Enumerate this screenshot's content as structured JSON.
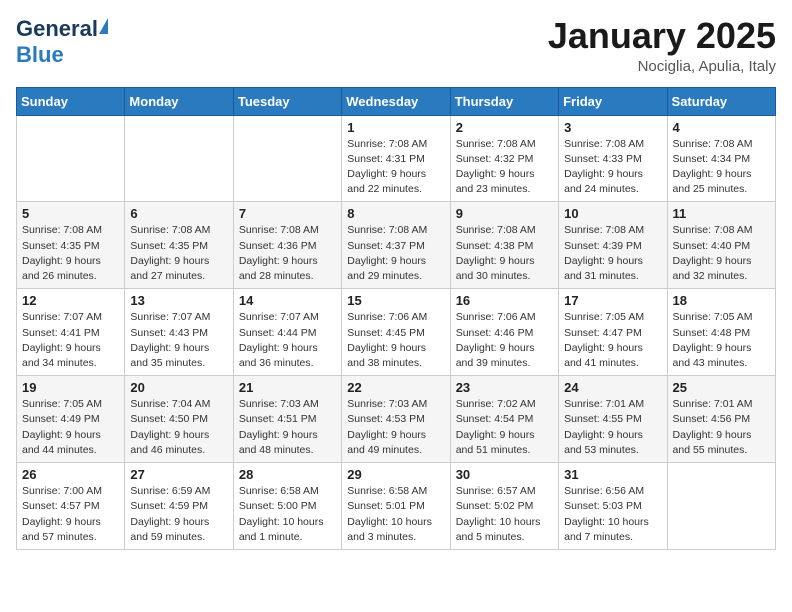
{
  "header": {
    "logo": {
      "general": "General",
      "blue": "Blue"
    },
    "title": "January 2025",
    "location": "Nociglia, Apulia, Italy"
  },
  "calendar": {
    "days_of_week": [
      "Sunday",
      "Monday",
      "Tuesday",
      "Wednesday",
      "Thursday",
      "Friday",
      "Saturday"
    ],
    "weeks": [
      [
        {
          "day": "",
          "info": ""
        },
        {
          "day": "",
          "info": ""
        },
        {
          "day": "",
          "info": ""
        },
        {
          "day": "1",
          "info": "Sunrise: 7:08 AM\nSunset: 4:31 PM\nDaylight: 9 hours\nand 22 minutes."
        },
        {
          "day": "2",
          "info": "Sunrise: 7:08 AM\nSunset: 4:32 PM\nDaylight: 9 hours\nand 23 minutes."
        },
        {
          "day": "3",
          "info": "Sunrise: 7:08 AM\nSunset: 4:33 PM\nDaylight: 9 hours\nand 24 minutes."
        },
        {
          "day": "4",
          "info": "Sunrise: 7:08 AM\nSunset: 4:34 PM\nDaylight: 9 hours\nand 25 minutes."
        }
      ],
      [
        {
          "day": "5",
          "info": "Sunrise: 7:08 AM\nSunset: 4:35 PM\nDaylight: 9 hours\nand 26 minutes."
        },
        {
          "day": "6",
          "info": "Sunrise: 7:08 AM\nSunset: 4:35 PM\nDaylight: 9 hours\nand 27 minutes."
        },
        {
          "day": "7",
          "info": "Sunrise: 7:08 AM\nSunset: 4:36 PM\nDaylight: 9 hours\nand 28 minutes."
        },
        {
          "day": "8",
          "info": "Sunrise: 7:08 AM\nSunset: 4:37 PM\nDaylight: 9 hours\nand 29 minutes."
        },
        {
          "day": "9",
          "info": "Sunrise: 7:08 AM\nSunset: 4:38 PM\nDaylight: 9 hours\nand 30 minutes."
        },
        {
          "day": "10",
          "info": "Sunrise: 7:08 AM\nSunset: 4:39 PM\nDaylight: 9 hours\nand 31 minutes."
        },
        {
          "day": "11",
          "info": "Sunrise: 7:08 AM\nSunset: 4:40 PM\nDaylight: 9 hours\nand 32 minutes."
        }
      ],
      [
        {
          "day": "12",
          "info": "Sunrise: 7:07 AM\nSunset: 4:41 PM\nDaylight: 9 hours\nand 34 minutes."
        },
        {
          "day": "13",
          "info": "Sunrise: 7:07 AM\nSunset: 4:43 PM\nDaylight: 9 hours\nand 35 minutes."
        },
        {
          "day": "14",
          "info": "Sunrise: 7:07 AM\nSunset: 4:44 PM\nDaylight: 9 hours\nand 36 minutes."
        },
        {
          "day": "15",
          "info": "Sunrise: 7:06 AM\nSunset: 4:45 PM\nDaylight: 9 hours\nand 38 minutes."
        },
        {
          "day": "16",
          "info": "Sunrise: 7:06 AM\nSunset: 4:46 PM\nDaylight: 9 hours\nand 39 minutes."
        },
        {
          "day": "17",
          "info": "Sunrise: 7:05 AM\nSunset: 4:47 PM\nDaylight: 9 hours\nand 41 minutes."
        },
        {
          "day": "18",
          "info": "Sunrise: 7:05 AM\nSunset: 4:48 PM\nDaylight: 9 hours\nand 43 minutes."
        }
      ],
      [
        {
          "day": "19",
          "info": "Sunrise: 7:05 AM\nSunset: 4:49 PM\nDaylight: 9 hours\nand 44 minutes."
        },
        {
          "day": "20",
          "info": "Sunrise: 7:04 AM\nSunset: 4:50 PM\nDaylight: 9 hours\nand 46 minutes."
        },
        {
          "day": "21",
          "info": "Sunrise: 7:03 AM\nSunset: 4:51 PM\nDaylight: 9 hours\nand 48 minutes."
        },
        {
          "day": "22",
          "info": "Sunrise: 7:03 AM\nSunset: 4:53 PM\nDaylight: 9 hours\nand 49 minutes."
        },
        {
          "day": "23",
          "info": "Sunrise: 7:02 AM\nSunset: 4:54 PM\nDaylight: 9 hours\nand 51 minutes."
        },
        {
          "day": "24",
          "info": "Sunrise: 7:01 AM\nSunset: 4:55 PM\nDaylight: 9 hours\nand 53 minutes."
        },
        {
          "day": "25",
          "info": "Sunrise: 7:01 AM\nSunset: 4:56 PM\nDaylight: 9 hours\nand 55 minutes."
        }
      ],
      [
        {
          "day": "26",
          "info": "Sunrise: 7:00 AM\nSunset: 4:57 PM\nDaylight: 9 hours\nand 57 minutes."
        },
        {
          "day": "27",
          "info": "Sunrise: 6:59 AM\nSunset: 4:59 PM\nDaylight: 9 hours\nand 59 minutes."
        },
        {
          "day": "28",
          "info": "Sunrise: 6:58 AM\nSunset: 5:00 PM\nDaylight: 10 hours\nand 1 minute."
        },
        {
          "day": "29",
          "info": "Sunrise: 6:58 AM\nSunset: 5:01 PM\nDaylight: 10 hours\nand 3 minutes."
        },
        {
          "day": "30",
          "info": "Sunrise: 6:57 AM\nSunset: 5:02 PM\nDaylight: 10 hours\nand 5 minutes."
        },
        {
          "day": "31",
          "info": "Sunrise: 6:56 AM\nSunset: 5:03 PM\nDaylight: 10 hours\nand 7 minutes."
        },
        {
          "day": "",
          "info": ""
        }
      ]
    ]
  }
}
